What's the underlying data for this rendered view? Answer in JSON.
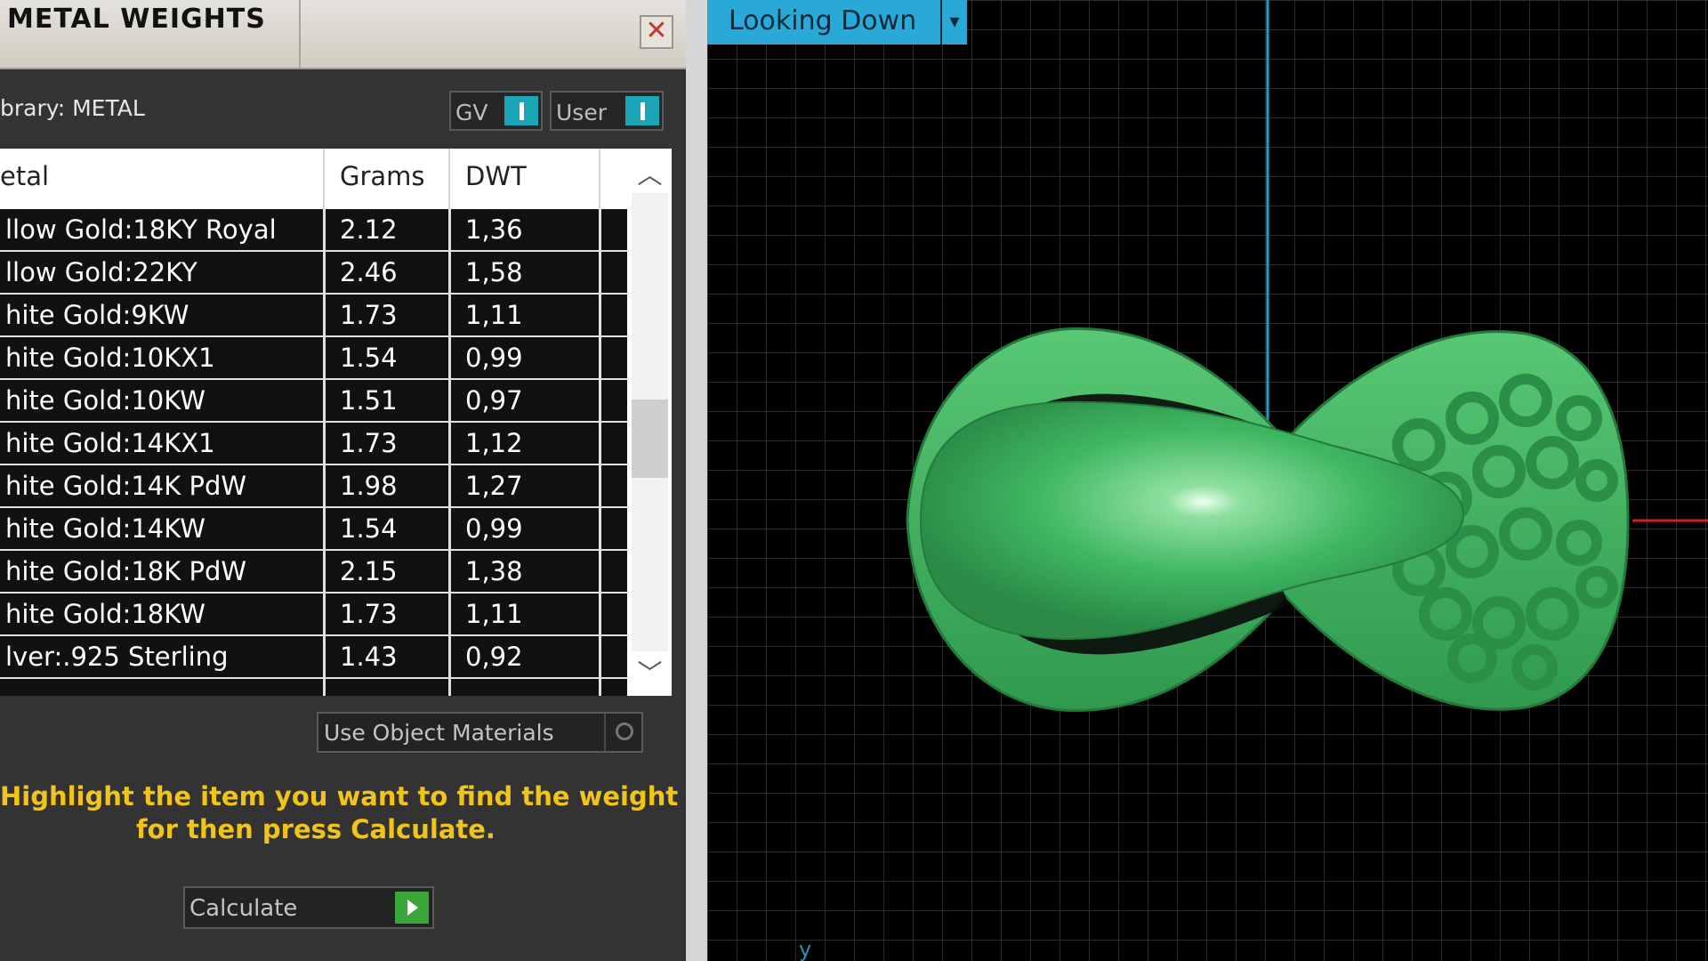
{
  "panel": {
    "title": "METAL WEIGHTS",
    "close_glyph": "✕",
    "library_label": "brary: METAL",
    "toggles": [
      {
        "label": "GV",
        "state": "on"
      },
      {
        "label": "User",
        "state": "on"
      }
    ]
  },
  "table": {
    "columns": [
      "etal",
      "Grams",
      "DWT"
    ],
    "rows": [
      {
        "metal": "llow Gold:18KY Royal",
        "grams": "2.12",
        "dwt": "1,36"
      },
      {
        "metal": "llow Gold:22KY",
        "grams": "2.46",
        "dwt": "1,58"
      },
      {
        "metal": "hite Gold:9KW",
        "grams": "1.73",
        "dwt": "1,11"
      },
      {
        "metal": "hite Gold:10KX1",
        "grams": "1.54",
        "dwt": "0,99"
      },
      {
        "metal": "hite Gold:10KW",
        "grams": "1.51",
        "dwt": "0,97"
      },
      {
        "metal": "hite Gold:14KX1",
        "grams": "1.73",
        "dwt": "1,12"
      },
      {
        "metal": "hite Gold:14K PdW",
        "grams": "1.98",
        "dwt": "1,27"
      },
      {
        "metal": "hite Gold:14KW",
        "grams": "1.54",
        "dwt": "0,99"
      },
      {
        "metal": "hite Gold:18K PdW",
        "grams": "2.15",
        "dwt": "1,38"
      },
      {
        "metal": "hite Gold:18KW",
        "grams": "1.73",
        "dwt": "1,11"
      },
      {
        "metal": "lver:.925 Sterling",
        "grams": "1.43",
        "dwt": "0,92"
      }
    ],
    "scroll_up_glyph": "︿",
    "scroll_down_glyph": "﹀"
  },
  "use_object_materials": {
    "label": "Use Object Materials",
    "checked": false
  },
  "hint": {
    "line1": "Highlight the item you want to find the weight",
    "line2": "for then press Calculate."
  },
  "calculate": {
    "label": "Calculate",
    "button_color": "#3aa63a"
  },
  "viewport": {
    "view_name": "Looking Down",
    "dropdown_glyph": "▾",
    "axis_label": "y",
    "grid_color": "#3a3a3a",
    "model_color": "#3fb862"
  },
  "colors": {
    "accent": "#29a9d8",
    "toggle_on": "#1aa6b7",
    "hint_text": "#f0c419",
    "x_axis": "#d81e1e",
    "y_axis": "#1fa0c6"
  }
}
